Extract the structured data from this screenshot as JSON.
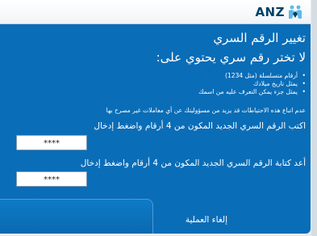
{
  "brand": {
    "name": "ANZ",
    "colors": {
      "panel": "#0a6db7",
      "navy": "#004165",
      "light_blue": "#5fb8e8"
    }
  },
  "page": {
    "title": "تغيير الرقم السري",
    "subtitle": "لا تختر رقم سري يحتوي على:",
    "bullets": [
      "أرقام متسلسلة (مثل 1234)",
      "يمثل تاريخ ميلادك",
      "يمثل جزء يمكن التعرف عليه من اسمك"
    ],
    "warning": "عدم اتباع هذه الاحتياطات قد يزيد من مسؤوليتك عن أي معاملات غير مصرح بها"
  },
  "new_pin": {
    "prompt": "اكتب الرقم السري الجديد المكون من 4 أرقام واضغط إدخال",
    "value": "****"
  },
  "confirm_pin": {
    "prompt": "أعد كتابة الرقم السري الجديد المكون من 4 أرقام واضغط إدخال",
    "value": "****"
  },
  "actions": {
    "cancel_label": "إلغاء العملية"
  }
}
